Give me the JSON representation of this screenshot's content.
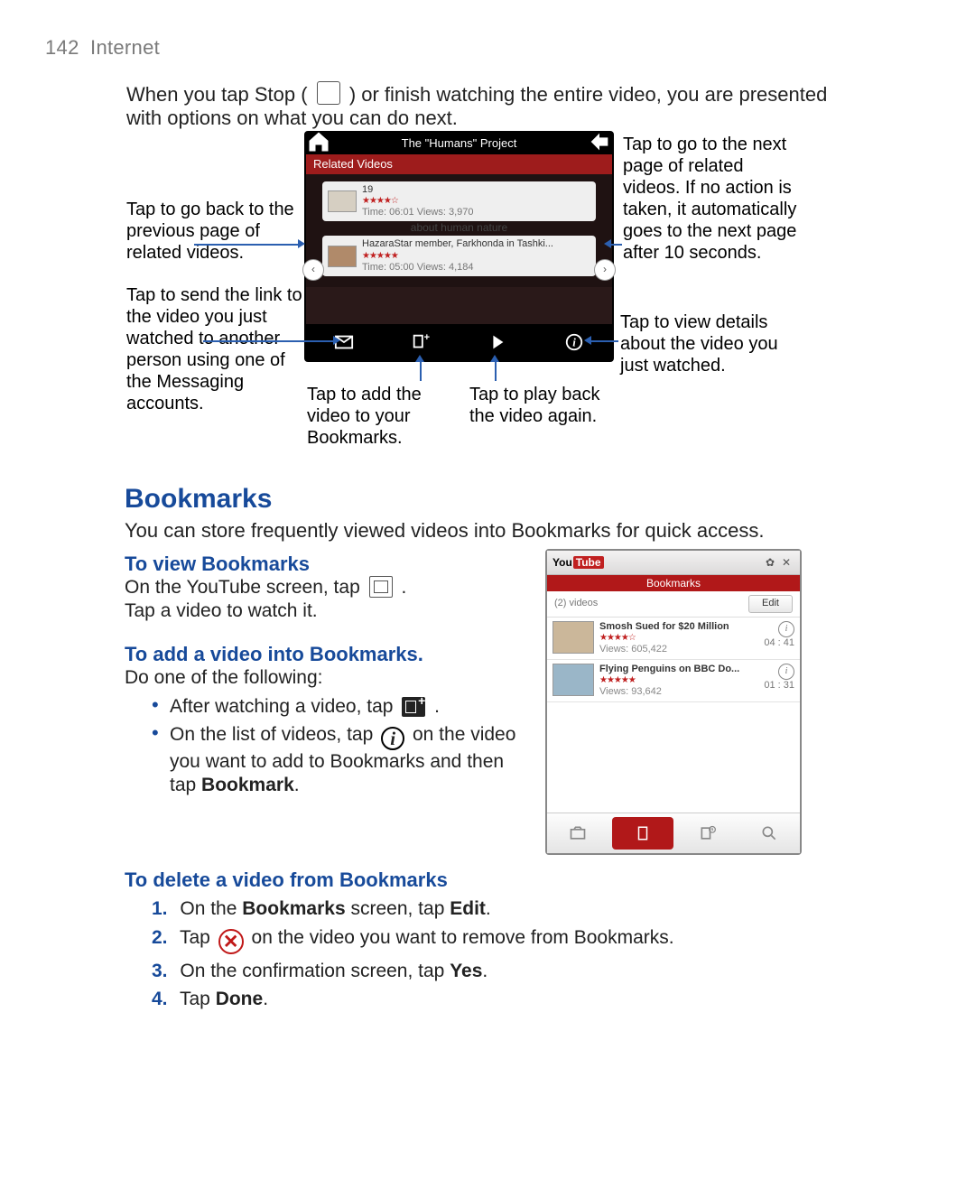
{
  "header": {
    "page_number": "142",
    "section": "Internet"
  },
  "intro": {
    "before_icon": "When you tap Stop (",
    "after_icon": ") or finish watching the entire video, you are presented with options on what you can do next."
  },
  "figure1": {
    "titlebar": "The \"Humans\" Project",
    "related_header": "Related Videos",
    "item1": {
      "title": "19",
      "stars": "★★★★☆",
      "meta": "Time: 06:01  Views: 3,970"
    },
    "name_row": "about human nature",
    "item2": {
      "title": "HazaraStar member, Farkhonda in Tashki...",
      "stars": "★★★★★",
      "meta": "Time: 05:00  Views: 4,184"
    },
    "callouts": {
      "left1": "Tap to go back to the previous page of related videos.",
      "left2": "Tap to send the link to the video you just watched to another person using one of the Messaging accounts.",
      "bottom1": "Tap to add the video to your Bookmarks.",
      "bottom2": "Tap to play back the video again.",
      "right1": "Tap to go to the next page of related videos. If no action is taken, it automatically goes to the next page after 10 seconds.",
      "right2": "Tap to view details about the video you just watched."
    }
  },
  "bookmarks": {
    "heading": "Bookmarks",
    "desc": "You can store frequently viewed videos into Bookmarks for quick access.",
    "view": {
      "heading": "To view Bookmarks",
      "line1_a": "On the YouTube screen, tap",
      "line1_b": ".",
      "line2": "Tap a video to watch it."
    },
    "add": {
      "heading": "To add a video into Bookmarks.",
      "lead": "Do one of the following:",
      "b1_a": "After watching a video, tap",
      "b1_b": ".",
      "b2_a": "On the list of videos, tap",
      "b2_b": "on the video you want to add to Bookmarks and then tap",
      "b2_bold": "Bookmark",
      "b2_c": "."
    },
    "del": {
      "heading": "To delete a video from Bookmarks",
      "s1_a": "On the",
      "s1_b": "Bookmarks",
      "s1_c": "screen, tap",
      "s1_d": "Edit",
      "s1_e": ".",
      "s2_a": "Tap",
      "s2_b": "on the video you want to remove from Bookmarks.",
      "s3_a": "On the confirmation screen, tap",
      "s3_b": "Yes",
      "s3_c": ".",
      "s4_a": "Tap",
      "s4_b": "Done",
      "s4_c": "."
    }
  },
  "figure2": {
    "redbar": "Bookmarks",
    "count": "(2) videos",
    "edit": "Edit",
    "row1": {
      "title": "Smosh Sued for $20 Million",
      "stars": "★★★★☆",
      "views": "Views: 605,422",
      "dur": "04 : 41"
    },
    "row2": {
      "title": "Flying Penguins on BBC Do...",
      "stars": "★★★★★",
      "views": "Views: 93,642",
      "dur": "01 : 31"
    }
  }
}
